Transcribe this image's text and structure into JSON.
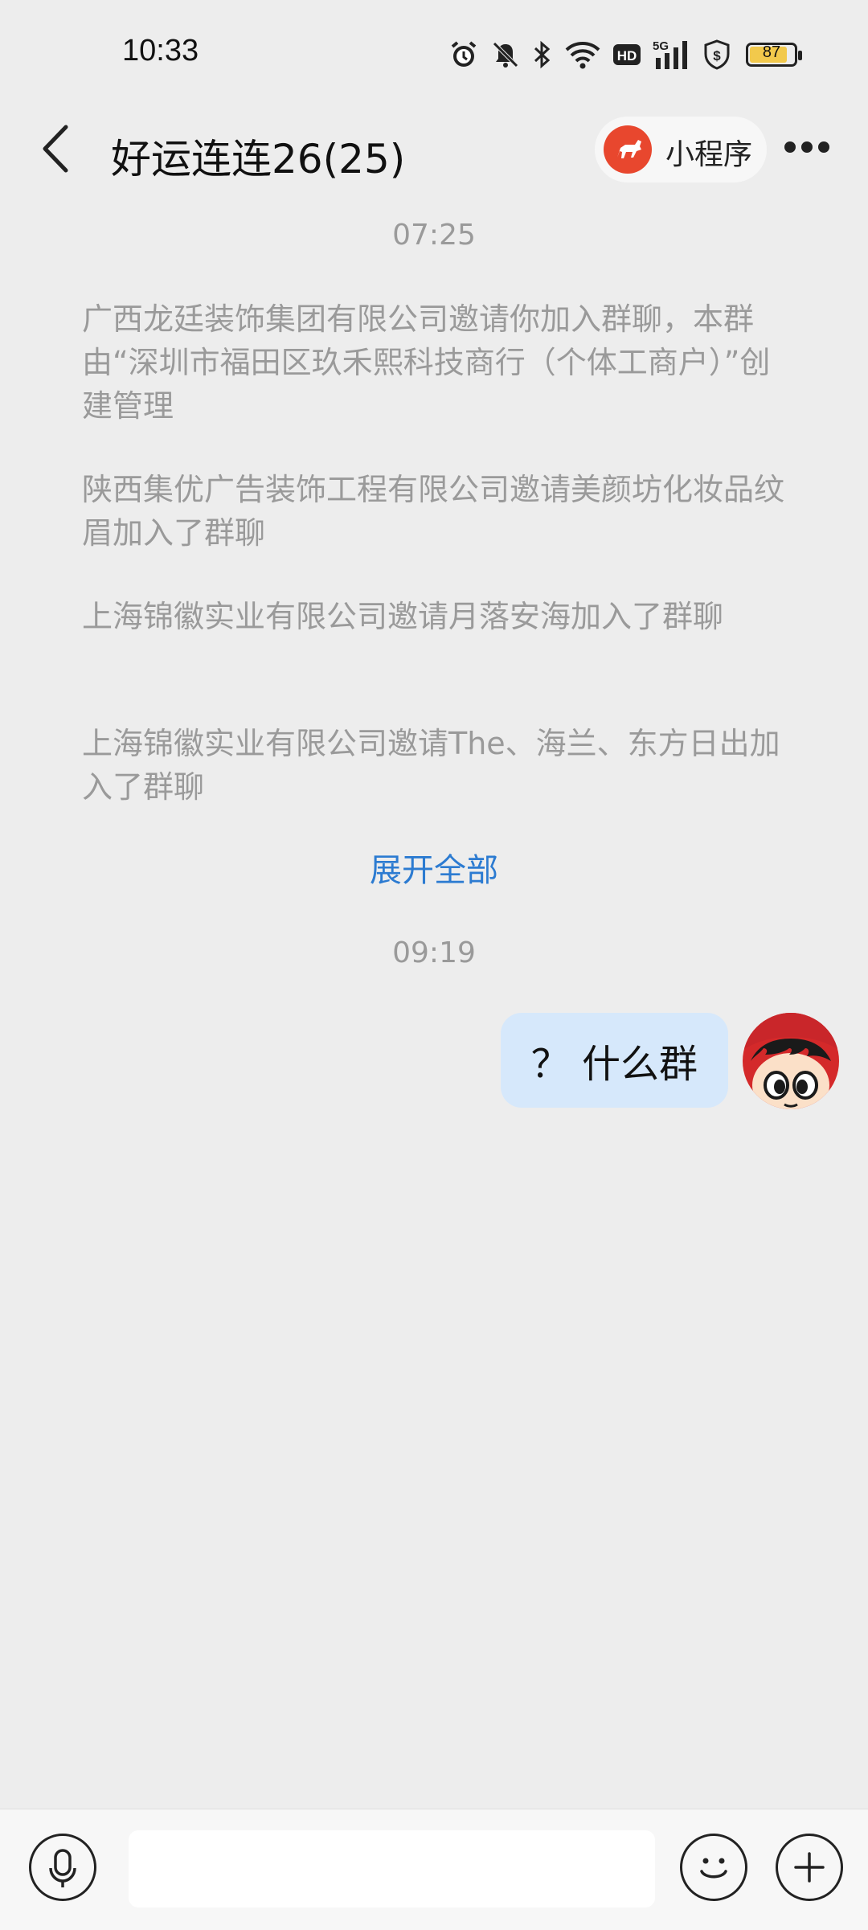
{
  "status_bar": {
    "time": "10:33",
    "battery_level": "87",
    "network_label": "5G",
    "hd_label": "HD",
    "icons": [
      "alarm-icon",
      "mute-icon",
      "bluetooth-icon",
      "wifi-icon",
      "hd-icon",
      "signal-icon",
      "shield-icon",
      "battery-icon"
    ]
  },
  "header": {
    "title": "好运连连26(25)",
    "mini_program_label": "小程序",
    "back_icon": "chevron-left-icon",
    "more_icon": "more-dots-icon",
    "mini_program_color": "#e8472e"
  },
  "chat": {
    "timestamp_1": "07:25",
    "system_messages": [
      "广西龙廷装饰集团有限公司邀请你加入群聊，本群由“深圳市福田区玖禾熙科技商行（个体工商户）”创建管理",
      "陕西集优广告装饰工程有限公司邀请美颜坊化妆品纹眉加入了群聊",
      "上海锦徽实业有限公司邀请月落安海加入了群聊",
      "上海锦徽实业有限公司邀请The、海兰、东方日出加入了群聊"
    ],
    "expand_label": "展开全部",
    "timestamp_2": "09:19",
    "my_message": "？ 什么群",
    "bubble_color": "#d6e8fb",
    "link_color": "#2c7bd1"
  },
  "input_bar": {
    "placeholder": "",
    "icons": [
      "microphone-icon",
      "emoji-icon",
      "plus-icon"
    ]
  }
}
